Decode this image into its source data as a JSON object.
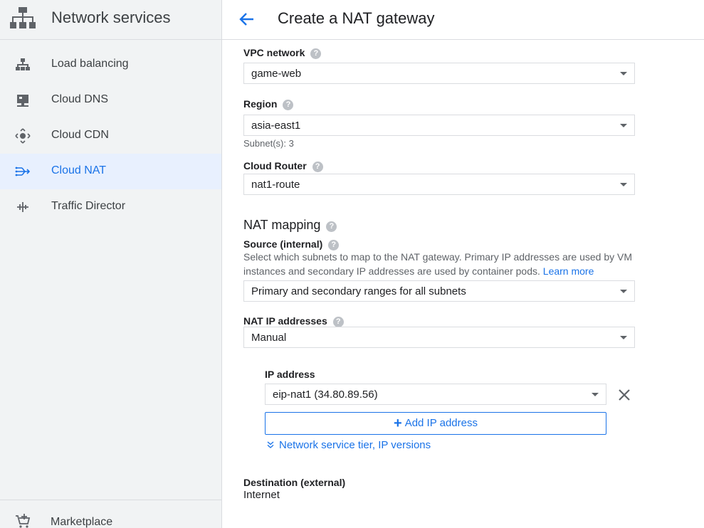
{
  "sidebar": {
    "title": "Network services",
    "items": [
      {
        "label": "Load balancing",
        "icon": "load-balancing-icon"
      },
      {
        "label": "Cloud DNS",
        "icon": "cloud-dns-icon"
      },
      {
        "label": "Cloud CDN",
        "icon": "cloud-cdn-icon"
      },
      {
        "label": "Cloud NAT",
        "icon": "cloud-nat-icon",
        "active": true
      },
      {
        "label": "Traffic Director",
        "icon": "traffic-director-icon"
      }
    ],
    "footer": {
      "label": "Marketplace",
      "icon": "marketplace-icon"
    }
  },
  "header": {
    "title": "Create a NAT gateway"
  },
  "form": {
    "vpc": {
      "label": "VPC network",
      "value": "game-web"
    },
    "region": {
      "label": "Region",
      "value": "asia-east1",
      "hint": "Subnet(s): 3"
    },
    "router": {
      "label": "Cloud Router",
      "value": "nat1-route"
    },
    "nat_mapping": {
      "title": "NAT mapping"
    },
    "source": {
      "label": "Source (internal)",
      "description": "Select which subnets to map to the NAT gateway. Primary IP addresses are used by VM instances and secondary IP addresses are used by container pods.",
      "learn_more": "Learn more",
      "value": "Primary and secondary ranges for all subnets"
    },
    "nat_ip": {
      "label": "NAT IP addresses",
      "value": "Manual"
    },
    "ip_address": {
      "label": "IP address",
      "value": "eip-nat1 (34.80.89.56)",
      "add_button": "Add IP address",
      "expander": "Network service tier, IP versions"
    },
    "destination": {
      "label": "Destination (external)",
      "value": "Internet"
    }
  },
  "colors": {
    "accent": "#1a73e8",
    "sidebar_bg": "#f1f3f4",
    "active_bg": "#e8f0fe"
  }
}
